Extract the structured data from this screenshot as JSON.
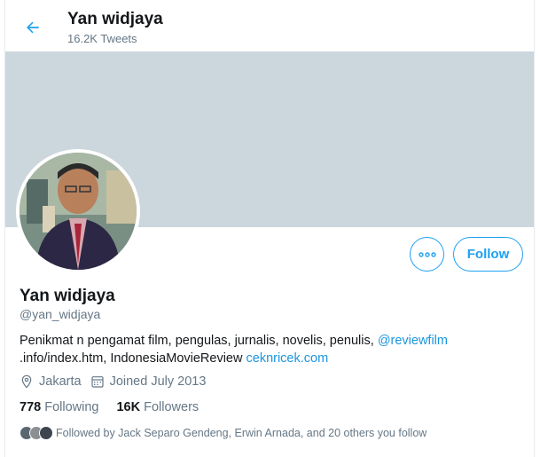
{
  "header": {
    "title": "Yan widjaya",
    "tweet_count": "16.2K Tweets"
  },
  "profile": {
    "name": "Yan widjaya",
    "handle": "@yan_widjaya",
    "bio_text_1": "Penikmat n pengamat film, pengulas, jurnalis,  novelis, penulis, ",
    "bio_link_1": "@reviewfilm",
    "bio_text_2": ".info/index.htm, IndonesiaMovieReview ",
    "bio_link_2": "ceknricek.com",
    "location": "Jakarta",
    "joined": "Joined July 2013",
    "following_count": "778",
    "following_label": "Following",
    "followers_count": "16K",
    "followers_label": "Followers",
    "followed_by": "Followed by Jack Separo Gendeng, Erwin Arnada, and 20 others you follow"
  },
  "actions": {
    "follow_label": "Follow",
    "more_icon": "more-icon"
  },
  "colors": {
    "accent": "#1da1f2",
    "banner": "#ccd6dd",
    "muted": "#657786"
  }
}
